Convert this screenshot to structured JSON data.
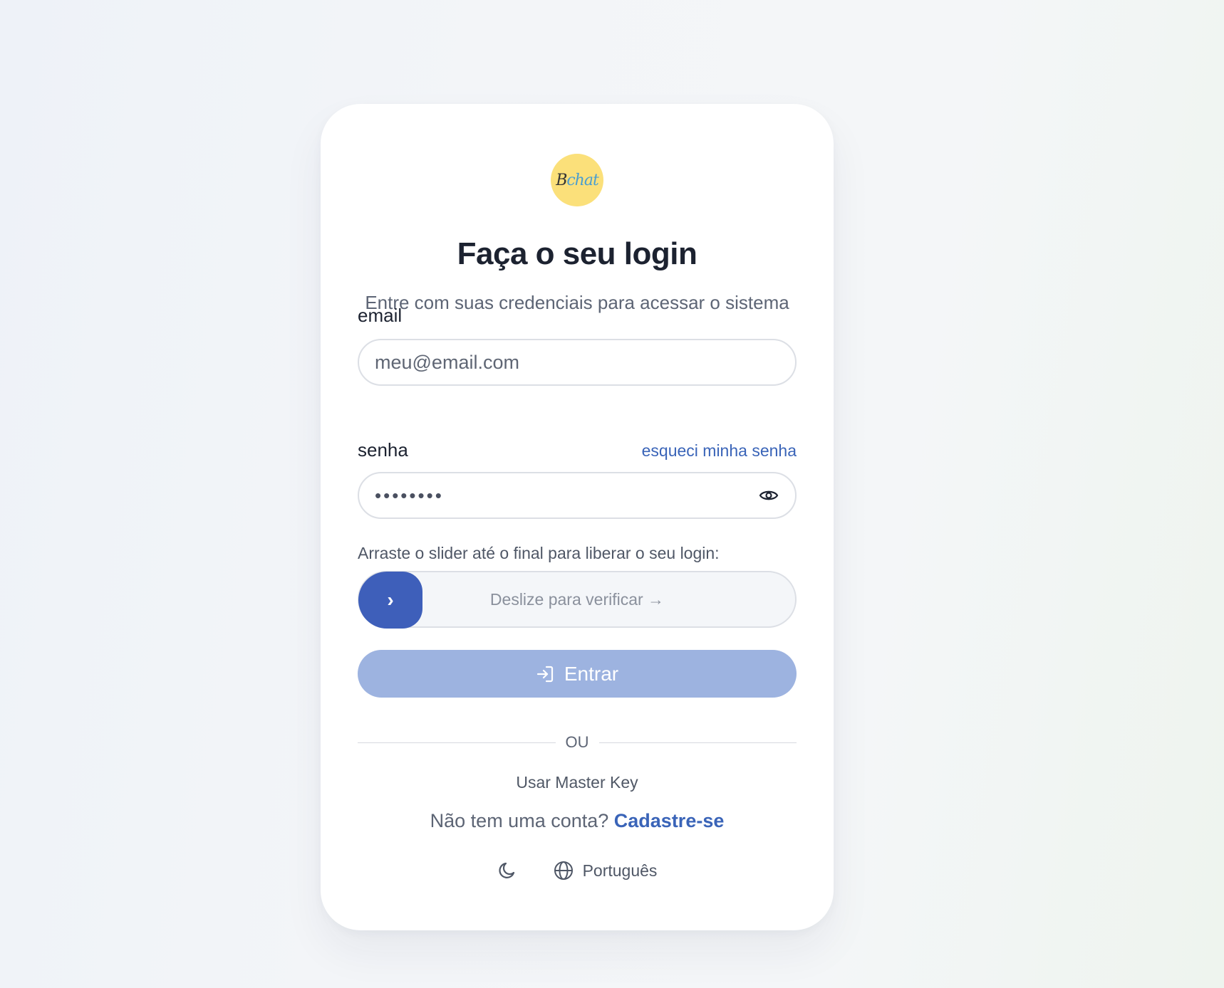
{
  "logo": {
    "text_a": "B",
    "text_b": "chat"
  },
  "title": "Faça o seu login",
  "subtitle": "Entre com suas credenciais para acessar o sistema",
  "email": {
    "label": "email",
    "placeholder": "meu@email.com",
    "value": ""
  },
  "password": {
    "label": "senha",
    "masked_value": "••••••••",
    "forgot_link": "esqueci minha senha"
  },
  "slider": {
    "hint": "Arraste o slider até o final para liberar o seu login:",
    "text": "Deslize para verificar →",
    "handle": "›"
  },
  "submit": {
    "label": "Entrar"
  },
  "divider": {
    "text": "OU"
  },
  "master_key": "Usar Master Key",
  "signup": {
    "prompt": "Não tem uma conta? ",
    "link": "Cadastre-se"
  },
  "footer": {
    "language": "Português"
  },
  "icons": [
    "login-icon",
    "eye-icon",
    "moon-icon",
    "globe-icon"
  ],
  "colors": {
    "primary": "#3e5fba",
    "primary_disabled": "#9db3e0",
    "link": "#3a64b8",
    "logo_bg": "#fbe07a"
  }
}
